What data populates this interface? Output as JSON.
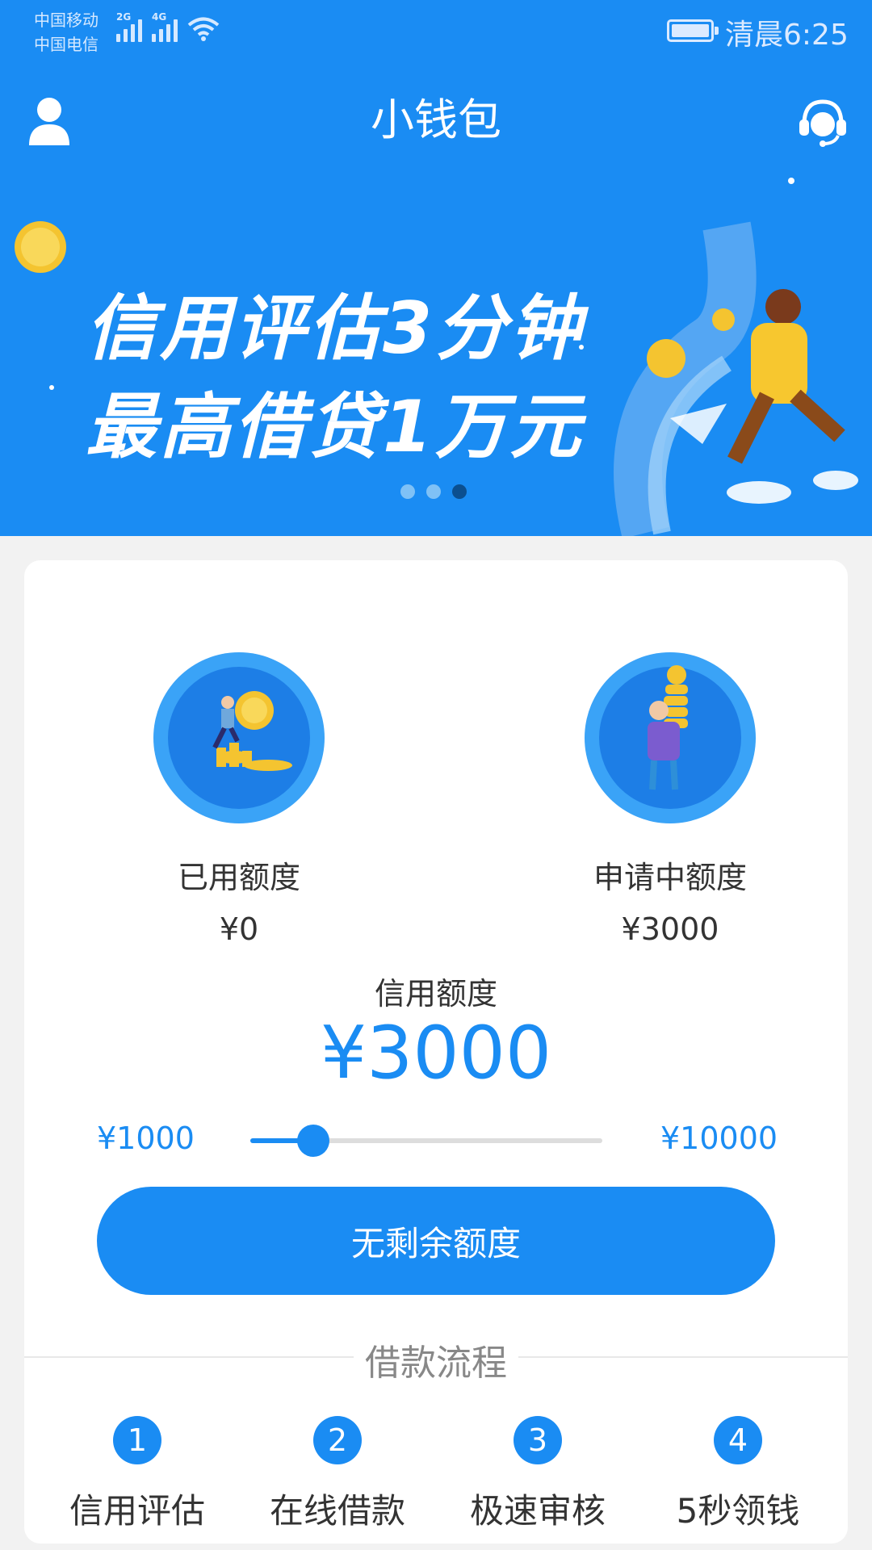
{
  "status_bar": {
    "carrier1": "中国移动",
    "carrier2": "中国电信",
    "network1": "2G",
    "network2": "4G",
    "time": "清晨6:25"
  },
  "header": {
    "title": "小钱包",
    "left_icon": "user-icon",
    "right_icon": "customer-service-icon"
  },
  "banner": {
    "line1": "信用评估3分钟",
    "line2": "最高借贷1万元",
    "dots": 3,
    "active_dot": 3
  },
  "stats": {
    "used": {
      "label": "已用额度",
      "value": "¥0"
    },
    "applying": {
      "label": "申请中额度",
      "value": "¥3000"
    }
  },
  "credit": {
    "label": "信用额度",
    "value": "¥3000",
    "min_label": "¥1000",
    "max_label": "¥10000",
    "min": 1000,
    "max": 10000,
    "current": 3000
  },
  "action_button": {
    "label": "无剩余额度"
  },
  "process": {
    "title": "借款流程",
    "steps": [
      {
        "num": "1",
        "label": "信用评估"
      },
      {
        "num": "2",
        "label": "在线借款"
      },
      {
        "num": "3",
        "label": "极速审核"
      },
      {
        "num": "4",
        "label": "5秒领钱"
      }
    ]
  },
  "colors": {
    "primary": "#1a8cf3",
    "text": "#333333",
    "muted": "#888888"
  }
}
